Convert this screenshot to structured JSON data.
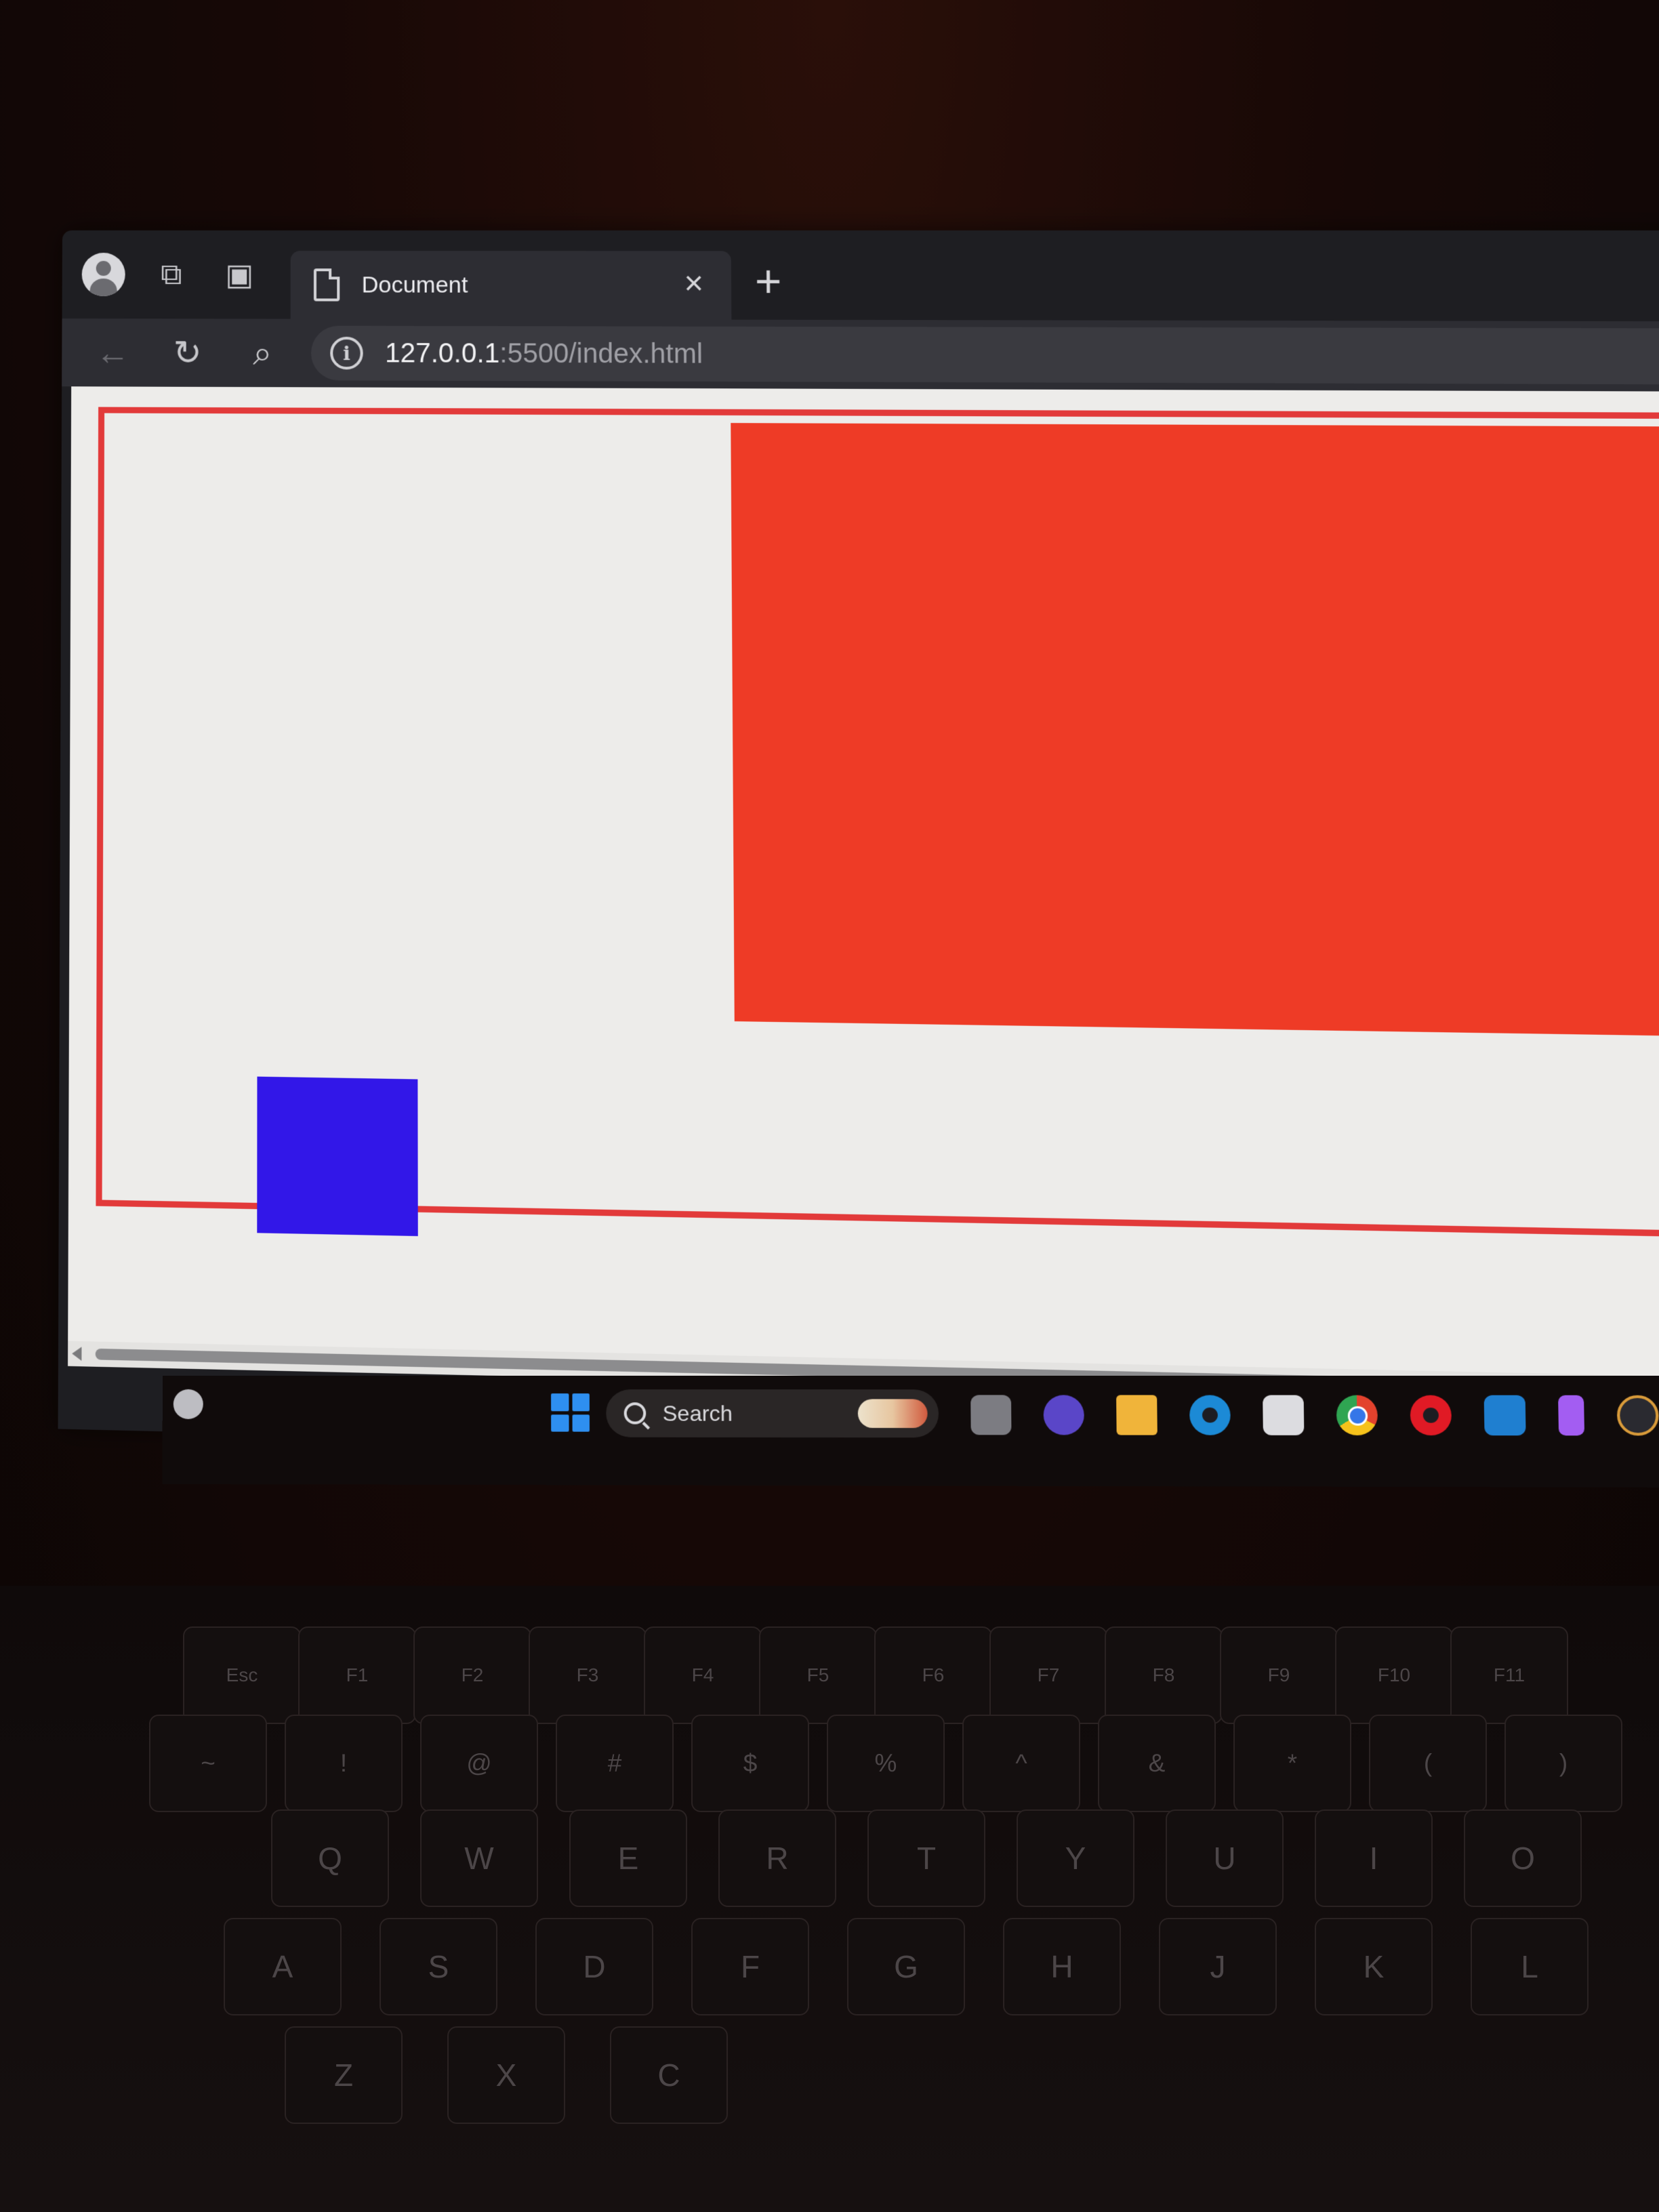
{
  "browser": {
    "tab": {
      "title": "Document"
    },
    "new_tab_symbol": "+",
    "close_symbol": "×",
    "address": {
      "host": "127.0.0.1",
      "rest": ":5500/index.html"
    },
    "toolbar_icons": [
      "profile-icon",
      "workspaces-icon",
      "sidebar-icon",
      "back-icon",
      "reload-icon",
      "search-icon",
      "site-info-icon"
    ]
  },
  "page": {
    "background": "#edecea",
    "outer_border_color": "#e23a3a",
    "red_box_color": "#ee3b26",
    "blue_box_color": "#3217e8"
  },
  "taskbar": {
    "search_label": "Search",
    "apps": [
      "windows-start-icon",
      "task-view-icon",
      "meet-icon",
      "file-explorer-icon",
      "edge-icon",
      "store-icon",
      "chrome-icon",
      "opera-icon",
      "vscode-icon",
      "figma-icon",
      "media-player-icon"
    ]
  },
  "keyboard": {
    "row_fn": [
      "Esc",
      "F1",
      "F2",
      "F3",
      "F4",
      "F5",
      "F6",
      "F7",
      "F8",
      "F9",
      "F10",
      "F11"
    ],
    "row_num": [
      "~",
      "!",
      "@",
      "#",
      "$",
      "%",
      "^",
      "&",
      "*",
      "(",
      ")"
    ],
    "row_top": [
      "Q",
      "W",
      "E",
      "R",
      "T",
      "Y",
      "U",
      "I",
      "O"
    ],
    "row_home": [
      "A",
      "S",
      "D",
      "F",
      "G",
      "H",
      "J",
      "K",
      "L"
    ],
    "row_bottom": [
      "Z",
      "X",
      "C"
    ]
  }
}
